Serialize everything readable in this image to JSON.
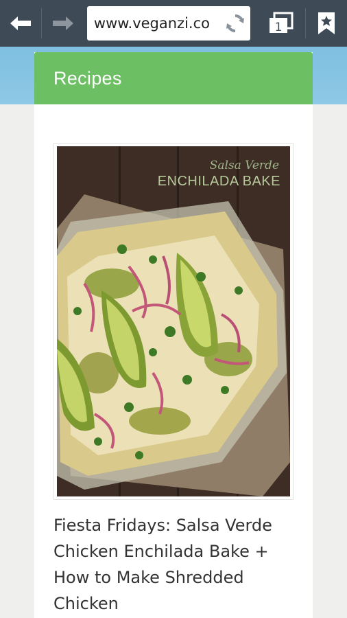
{
  "browser": {
    "url": "www.veganzi.co",
    "tab_count": "1",
    "icons": {
      "back": "back-arrow-icon",
      "forward": "forward-arrow-icon",
      "reload": "reload-icon",
      "tabs": "tabs-icon",
      "bookmark": "bookmark-star-icon"
    }
  },
  "section": {
    "title": "Recipes"
  },
  "article": {
    "image_caption_line1": "Salsa Verde",
    "image_caption_line2": "ENCHILADA BAKE",
    "title": "Fiesta Fridays: Salsa Verde Chicken Enchilada Bake + How to Make Shredded Chicken"
  },
  "colors": {
    "toolbar": "#3f4a57",
    "header_green": "#6cc063",
    "band_blue": "#8ec9e6"
  }
}
